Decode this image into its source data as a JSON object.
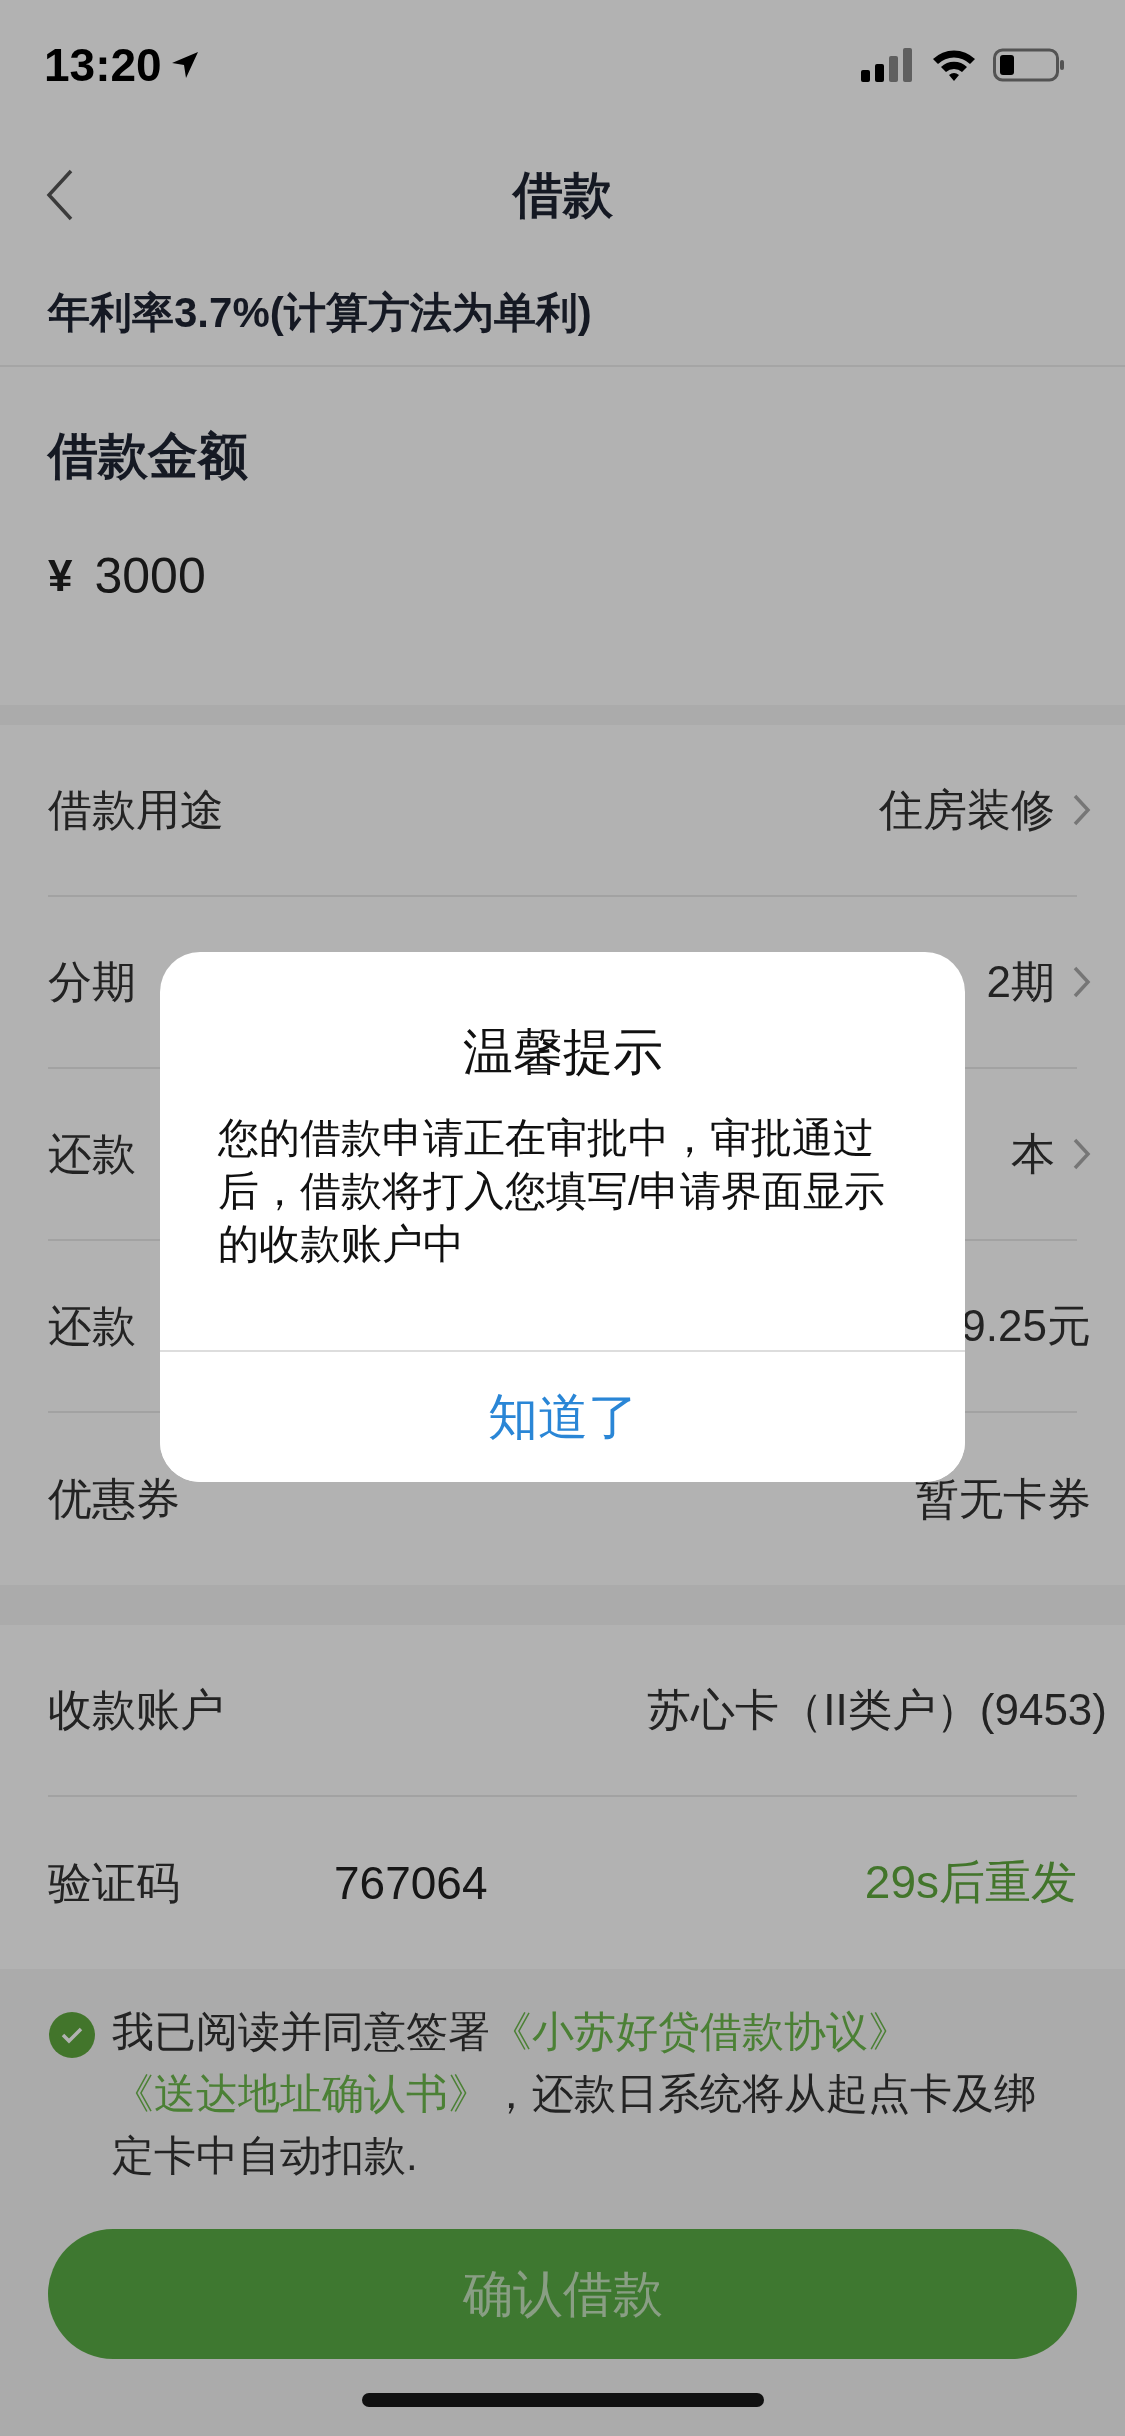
{
  "status_bar": {
    "time": "13:20"
  },
  "nav": {
    "title": "借款"
  },
  "rate_note": "年利率3.7%(计算方法为单利)",
  "amount": {
    "label": "借款金额",
    "currency": "¥",
    "value": "3000"
  },
  "loan_rows": [
    {
      "label": "借款用途",
      "value": "住房装修",
      "chevron": true
    },
    {
      "label": "分期",
      "value": "2期",
      "chevron": true
    },
    {
      "label": "还款",
      "value": "本",
      "chevron": true
    },
    {
      "label": "还款",
      "value": "9.25元",
      "chevron": false
    },
    {
      "label": "优惠券",
      "value": "暂无卡券",
      "chevron": false
    }
  ],
  "account_rows": [
    {
      "kind": "value",
      "label": "收款账户",
      "value": "苏心卡（II类户）(9453)"
    },
    {
      "kind": "code",
      "label": "验证码",
      "value": "767064",
      "action": "29s后重发"
    }
  ],
  "agreement": {
    "checked": true,
    "parts": [
      {
        "kind": "text",
        "text": "我已阅读并同意签署"
      },
      {
        "kind": "link",
        "text": "《小苏好贷借款协议》"
      },
      {
        "kind": "link",
        "text": "《送达地址确认书》"
      },
      {
        "kind": "text",
        "text": "，还款日系统将从起点卡及绑定卡中自动扣款."
      }
    ]
  },
  "confirm_button": "确认借款",
  "dialog": {
    "title": "温馨提示",
    "message": "您的借款申请正在审批中，审批通过后，借款将打入您填写/申请界面显示的收款账户中",
    "button": "知道了"
  }
}
